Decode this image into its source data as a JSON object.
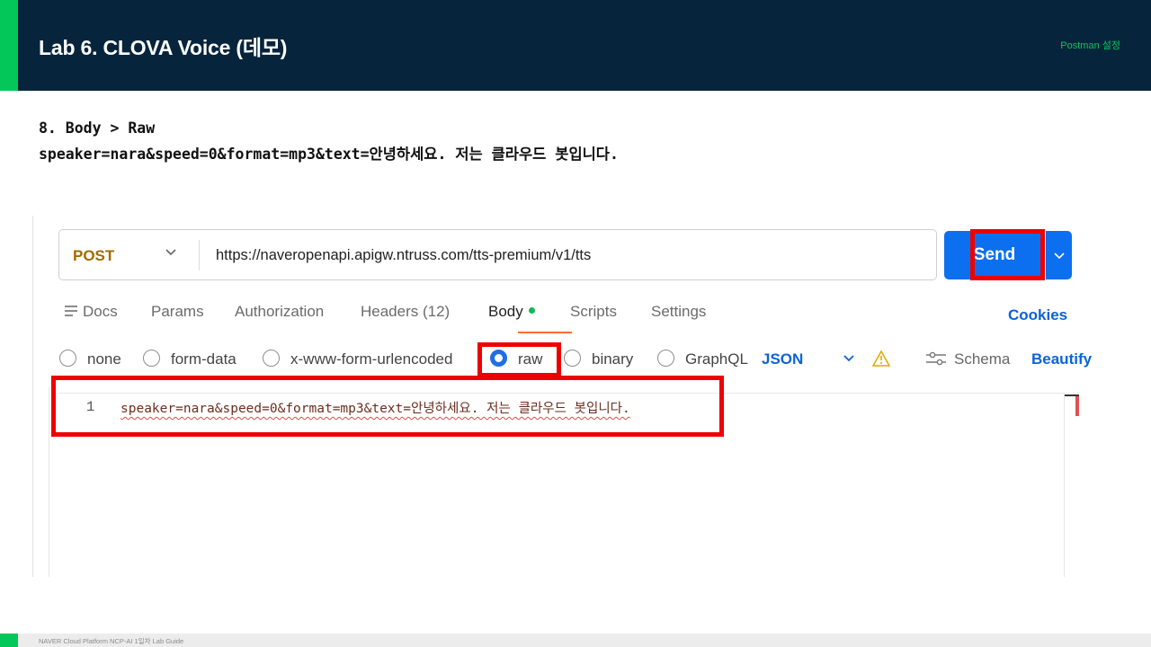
{
  "slide": {
    "title": "Lab 6. CLOVA Voice (데모)",
    "section_tag": "Postman 설정",
    "instruction_line1": "8. Body > Raw",
    "instruction_line2": "speaker=nara&speed=0&format=mp3&text=안녕하세요. 저는 클라우드 봇입니다.",
    "footer": "NAVER Cloud Platform  NCP-AI 1일차 Lab Guide"
  },
  "colors": {
    "header_bg": "#06253c",
    "brand_green": "#04c75a",
    "send_blue": "#0c6ff0",
    "highlight_red": "#ee0000",
    "method_post": "#a36a00"
  },
  "request": {
    "method": "POST",
    "url": "https://naveropenapi.apigw.ntruss.com/tts-premium/v1/tts",
    "send_label": "Send"
  },
  "tabs": {
    "docs": "Docs",
    "params": "Params",
    "authorization": "Authorization",
    "headers": "Headers (12)",
    "body": "Body",
    "scripts": "Scripts",
    "settings": "Settings",
    "cookies": "Cookies"
  },
  "body_modes": {
    "none": "none",
    "form_data": "form-data",
    "urlencoded": "x-www-form-urlencoded",
    "raw": "raw",
    "binary": "binary",
    "graphql": "GraphQL",
    "selected": "raw",
    "format": "JSON",
    "schema": "Schema",
    "beautify": "Beautify"
  },
  "editor": {
    "line_number": "1",
    "content": "speaker=nara&speed=0&format=mp3&text=안녕하세요. 저는 클라우드 봇입니다."
  }
}
